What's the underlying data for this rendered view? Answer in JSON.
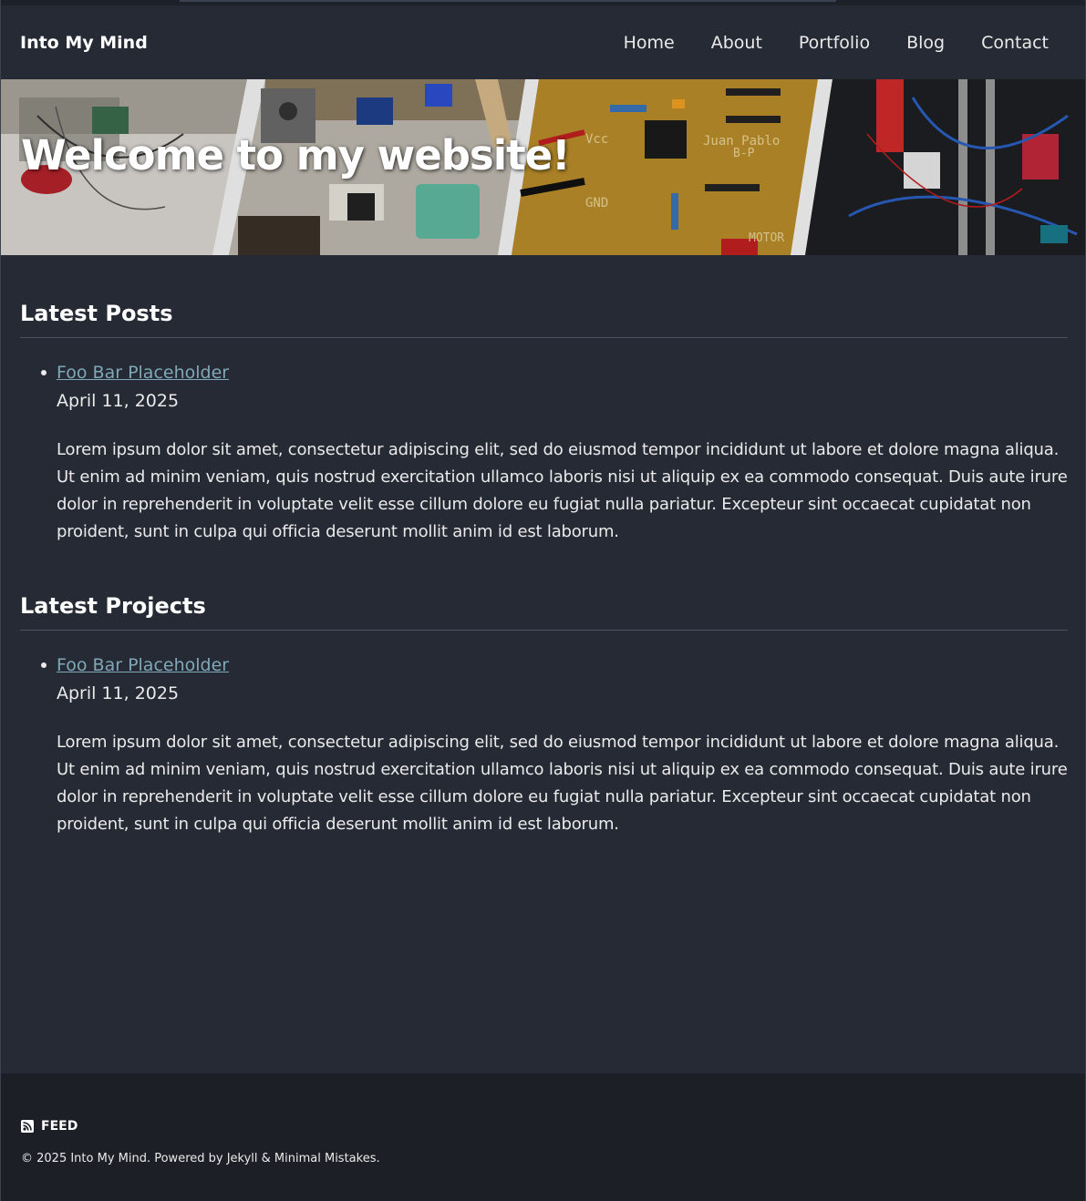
{
  "site": {
    "title": "Into My Mind"
  },
  "nav": {
    "items": [
      {
        "label": "Home"
      },
      {
        "label": "About"
      },
      {
        "label": "Portfolio"
      },
      {
        "label": "Blog"
      },
      {
        "label": "Contact"
      }
    ]
  },
  "hero": {
    "title": "Welcome to my website!",
    "image_labels": {
      "vcc": "Vcc",
      "gnd": "GND",
      "name": "Juan Pablo",
      "initials": "B-P",
      "motor": "MOTOR"
    }
  },
  "latest_posts": {
    "heading": "Latest Posts",
    "items": [
      {
        "title": "Foo Bar Placeholder",
        "date": "April 11, 2025",
        "excerpt": "Lorem ipsum dolor sit amet, consectetur adipiscing elit, sed do eiusmod tempor incididunt ut labore et dolore magna aliqua. Ut enim ad minim veniam, quis nostrud exercitation ullamco laboris nisi ut aliquip ex ea commodo consequat. Duis aute irure dolor in reprehenderit in voluptate velit esse cillum dolore eu fugiat nulla pariatur. Excepteur sint occaecat cupidatat non proident, sunt in culpa qui officia deserunt mollit anim id est laborum."
      }
    ]
  },
  "latest_projects": {
    "heading": "Latest Projects",
    "items": [
      {
        "title": "Foo Bar Placeholder",
        "date": "April 11, 2025",
        "excerpt": "Lorem ipsum dolor sit amet, consectetur adipiscing elit, sed do eiusmod tempor incididunt ut labore et dolore magna aliqua. Ut enim ad minim veniam, quis nostrud exercitation ullamco laboris nisi ut aliquip ex ea commodo consequat. Duis aute irure dolor in reprehenderit in voluptate velit esse cillum dolore eu fugiat nulla pariatur. Excepteur sint occaecat cupidatat non proident, sunt in culpa qui officia deserunt mollit anim id est laborum."
      }
    ]
  },
  "footer": {
    "feed_label": "FEED",
    "feed_icon": "rss-icon",
    "copyright": "© 2025 Into My Mind. Powered by Jekyll & Minimal Mistakes."
  },
  "colors": {
    "background": "#252a34",
    "footer_background": "#1c1f26",
    "link": "#7fa8b8",
    "text": "#eaeaea"
  }
}
